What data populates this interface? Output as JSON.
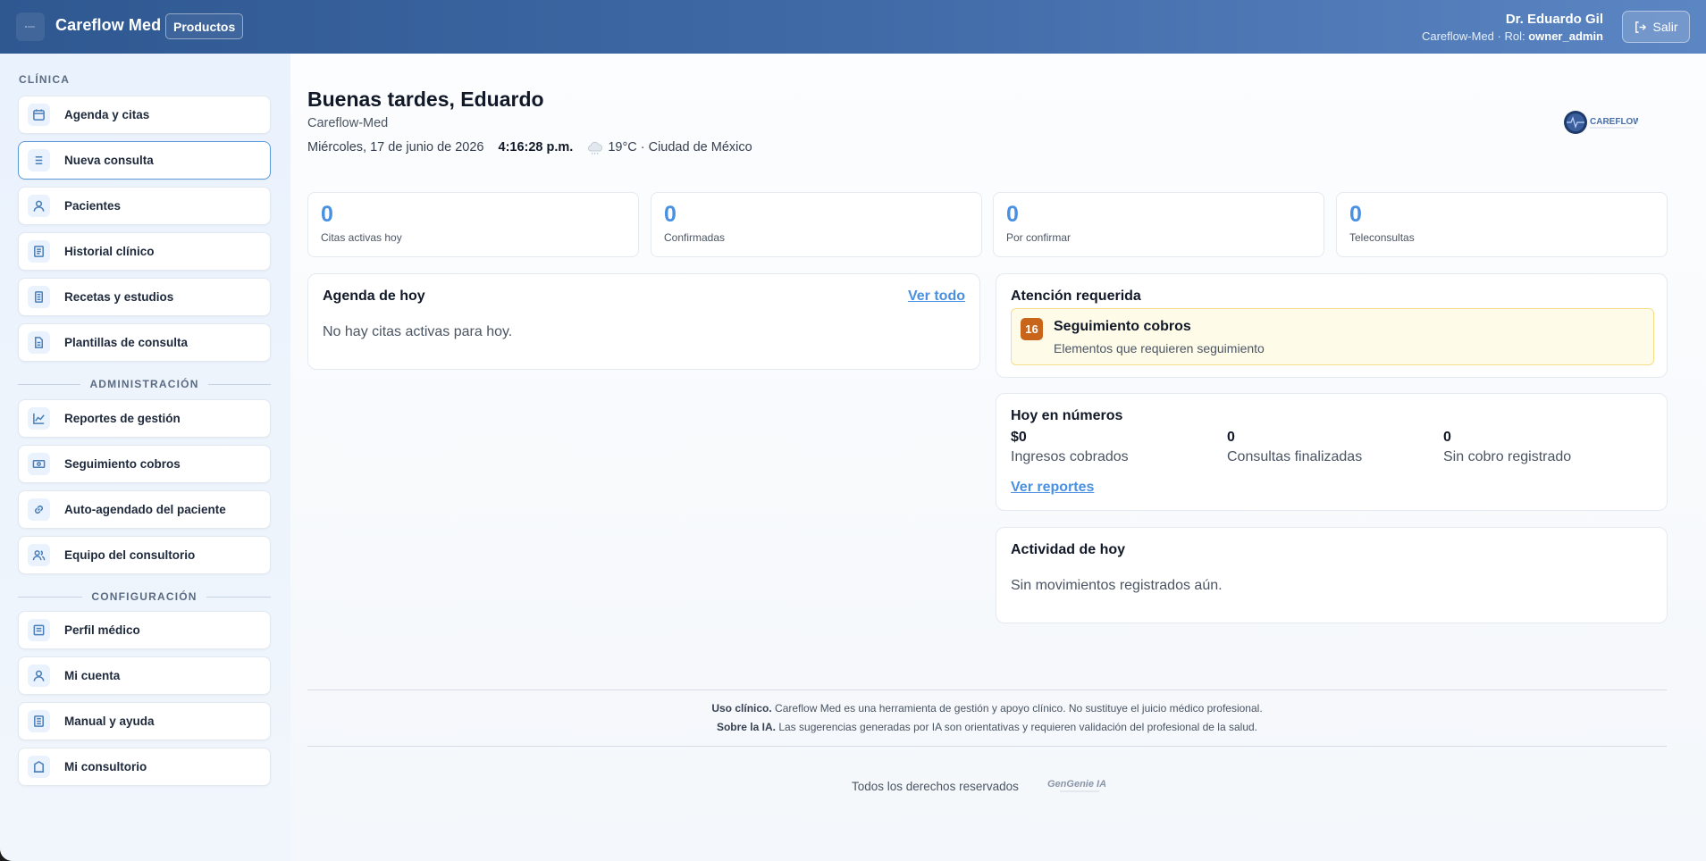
{
  "header": {
    "brand": "Careflow Med",
    "products_label": "Productos",
    "user_name": "Dr. Eduardo Gil",
    "user_org": "Careflow-Med · Rol:",
    "user_role": "owner_admin",
    "logout_label": "Salir"
  },
  "sidebar": {
    "section_clinic": "CLÍNICA",
    "section_admin": "ADMINISTRACIÓN",
    "section_config": "CONFIGURACIÓN",
    "clinic_items": [
      {
        "label": "Agenda y citas",
        "icon": "calendar-icon"
      },
      {
        "label": "Nueva consulta",
        "icon": "list-icon"
      },
      {
        "label": "Pacientes",
        "icon": "user-icon"
      },
      {
        "label": "Historial clínico",
        "icon": "book-icon"
      },
      {
        "label": "Recetas y estudios",
        "icon": "document-icon"
      },
      {
        "label": "Plantillas de consulta",
        "icon": "file-icon"
      }
    ],
    "admin_items": [
      {
        "label": "Reportes de gestión",
        "icon": "chart-icon"
      },
      {
        "label": "Seguimiento cobros",
        "icon": "money-icon"
      },
      {
        "label": "Auto-agendado del paciente",
        "icon": "link-icon"
      },
      {
        "label": "Equipo del consultorio",
        "icon": "users-icon"
      }
    ],
    "config_items": [
      {
        "label": "Perfil médico",
        "icon": "id-card-icon"
      },
      {
        "label": "Mi cuenta",
        "icon": "user-icon"
      },
      {
        "label": "Manual y ayuda",
        "icon": "manual-icon"
      },
      {
        "label": "Mi consultorio",
        "icon": "building-icon"
      }
    ]
  },
  "main": {
    "greeting": "Buenas tardes, Eduardo",
    "clinic_name": "Careflow-Med",
    "date": "Miércoles, 17 de junio de 2026",
    "time": "4:16:28 p.m.",
    "weather": "19°C · Ciudad de México",
    "logo_text": "CAREFLOW",
    "stats": [
      {
        "value": "0",
        "label": "Citas activas hoy"
      },
      {
        "value": "0",
        "label": "Confirmadas"
      },
      {
        "value": "0",
        "label": "Por confirmar"
      },
      {
        "value": "0",
        "label": "Teleconsultas"
      }
    ],
    "agenda": {
      "title": "Agenda de hoy",
      "link": "Ver todo",
      "empty": "No hay citas activas para hoy."
    },
    "attention": {
      "title": "Atención requerida",
      "badge": "16",
      "item_title": "Seguimiento cobros",
      "item_sub": "Elementos que requieren seguimiento"
    },
    "numbers": {
      "title": "Hoy en números",
      "items": [
        {
          "value": "$0",
          "label": "Ingresos cobrados"
        },
        {
          "value": "0",
          "label": "Consultas finalizadas"
        },
        {
          "value": "0",
          "label": "Sin cobro registrado"
        }
      ],
      "link": "Ver reportes"
    },
    "activity": {
      "title": "Actividad de hoy",
      "empty": "Sin movimientos registrados aún."
    }
  },
  "footer": {
    "clinical_bold": "Uso clínico.",
    "clinical_text": " Careflow Med es una herramienta de gestión y apoyo clínico. No sustituye el juicio médico profesional.",
    "ai_bold": "Sobre la IA.",
    "ai_text": " Las sugerencias generadas por IA son orientativas y requieren validación del profesional de la salud.",
    "copyright": "Todos los derechos reservados",
    "logo_text": "GenGenie IA"
  },
  "colors": {
    "accent": "#4a90e2",
    "header_start": "#2f5891",
    "header_end": "#5b86c3",
    "alert_bg": "#fefbe8",
    "badge": "#c9651b"
  }
}
